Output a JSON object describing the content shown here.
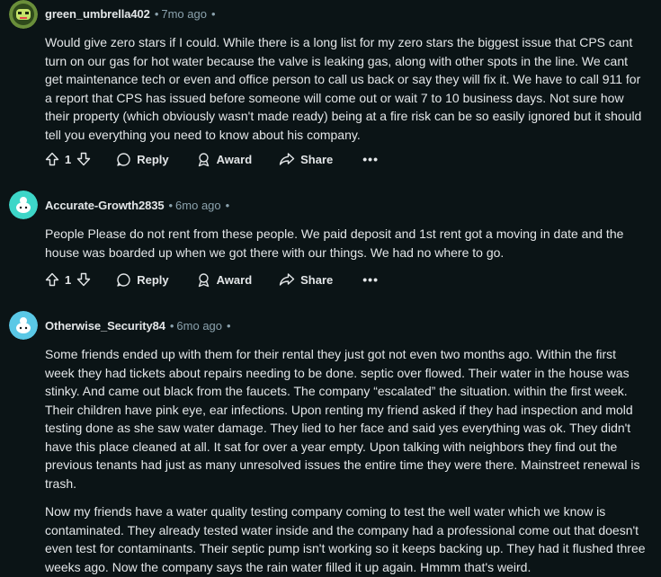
{
  "comments": [
    {
      "author": "green_umbrella402",
      "time": "7mo ago",
      "paragraphs": [
        "Would give zero stars if I could. While there is a long list for my zero stars the biggest issue that CPS cant turn on our gas for hot water because the valve is leaking gas, along with other spots in the line. We cant get maintenance tech or even and office person to call us back or say they will fix it. We have to call 911 for a report that CPS has issued before someone will come out or wait 7 to 10 business days. Not sure how their property (which obviously wasn't made ready) being at a fire risk can be so easily ignored but it should tell you everything you need to know about his company."
      ],
      "votes": "1"
    },
    {
      "author": "Accurate-Growth2835",
      "time": "6mo ago",
      "paragraphs": [
        "People Please do not rent from these people. We paid deposit and 1st rent got a moving in date and the house was boarded up when we got there with our things. We had no where to go."
      ],
      "votes": "1"
    },
    {
      "author": "Otherwise_Security84",
      "time": "6mo ago",
      "paragraphs": [
        "Some friends ended up with them for their rental they just got not even two months ago. Within the first week they had tickets about repairs needing to be done. septic over flowed. Their water in the house was stinky. And came out black from the faucets.  The company “escalated” the situation. within the first week. Their children have pink eye, ear infections. Upon renting my friend asked if they had inspection and mold testing done as she saw water damage. They lied to her face and said yes everything was ok. They didn't have this place cleaned at all. It sat for over a year empty. Upon talking with neighbors they find out the previous tenants had just as many unresolved issues the entire time they were there. Mainstreet renewal is trash.",
        "Now my friends have a water quality testing company coming to test the well water which we know is contaminated. They already tested water inside and the company had a professional come out that doesn't even test for contaminants.  Their septic pump isn't working so it keeps backing up. They had it flushed three weeks ago. Now the company says the rain water filled it up again. Hmmm that's weird."
      ]
    }
  ],
  "actions": {
    "reply": "Reply",
    "award": "Award",
    "share": "Share",
    "more": "•••"
  },
  "separator": "•",
  "icons": [
    "upvote-icon",
    "downvote-icon",
    "comment-icon",
    "award-icon",
    "share-icon",
    "more-icon",
    "avatar-icon"
  ],
  "colors": {
    "background": "#0b1416",
    "text": "#e3e6e8",
    "meta": "#8ba2ad",
    "avatar_teal": "#3dd6c8",
    "avatar_blue": "#5ac8e6"
  }
}
